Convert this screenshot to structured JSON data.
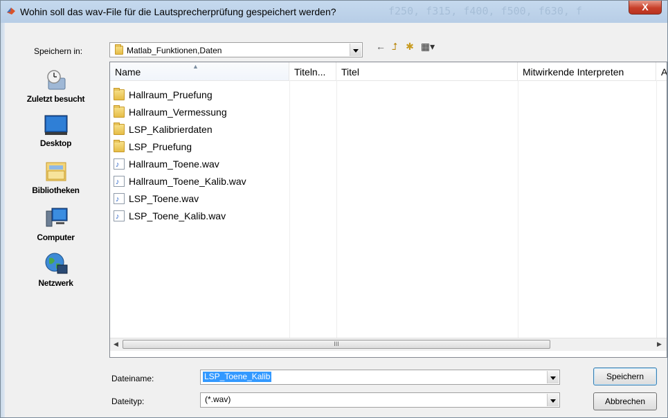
{
  "window": {
    "title": "Wohin soll das wav-File für die Lautsprecherprüfung gespeichert werden?",
    "background_code": "f250, f315, f400, f500, f630, f",
    "close_label": "X"
  },
  "save_in": {
    "label": "Speichern in:",
    "value": "Matlab_Funktionen,Daten"
  },
  "toolbar": {
    "back_icon": "back-arrow-icon",
    "up_icon": "up-folder-icon",
    "new_folder_icon": "new-folder-icon",
    "view_icon": "view-menu-icon"
  },
  "places": [
    {
      "label": "Zuletzt besucht",
      "icon": "recent-places-icon"
    },
    {
      "label": "Desktop",
      "icon": "desktop-icon"
    },
    {
      "label": "Bibliotheken",
      "icon": "libraries-icon"
    },
    {
      "label": "Computer",
      "icon": "computer-icon"
    },
    {
      "label": "Netzwerk",
      "icon": "network-icon"
    }
  ],
  "columns": [
    "Name",
    "Titeln...",
    "Titel",
    "Mitwirkende Interpreten",
    "A"
  ],
  "files": [
    {
      "name": "Hallraum_Pruefung",
      "type": "folder"
    },
    {
      "name": "Hallraum_Vermessung",
      "type": "folder"
    },
    {
      "name": "LSP_Kalibrierdaten",
      "type": "folder"
    },
    {
      "name": "LSP_Pruefung",
      "type": "folder"
    },
    {
      "name": "Hallraum_Toene.wav",
      "type": "wav"
    },
    {
      "name": "Hallraum_Toene_Kalib.wav",
      "type": "wav"
    },
    {
      "name": "LSP_Toene.wav",
      "type": "wav"
    },
    {
      "name": "LSP_Toene_Kalib.wav",
      "type": "wav"
    }
  ],
  "scrollbar": {
    "grip": "III"
  },
  "filename": {
    "label": "Dateiname:",
    "value": "LSP_Toene_Kalib"
  },
  "filetype": {
    "label": "Dateityp:",
    "value": "(*.wav)"
  },
  "buttons": {
    "save": "Speichern",
    "cancel": "Abbrechen"
  }
}
